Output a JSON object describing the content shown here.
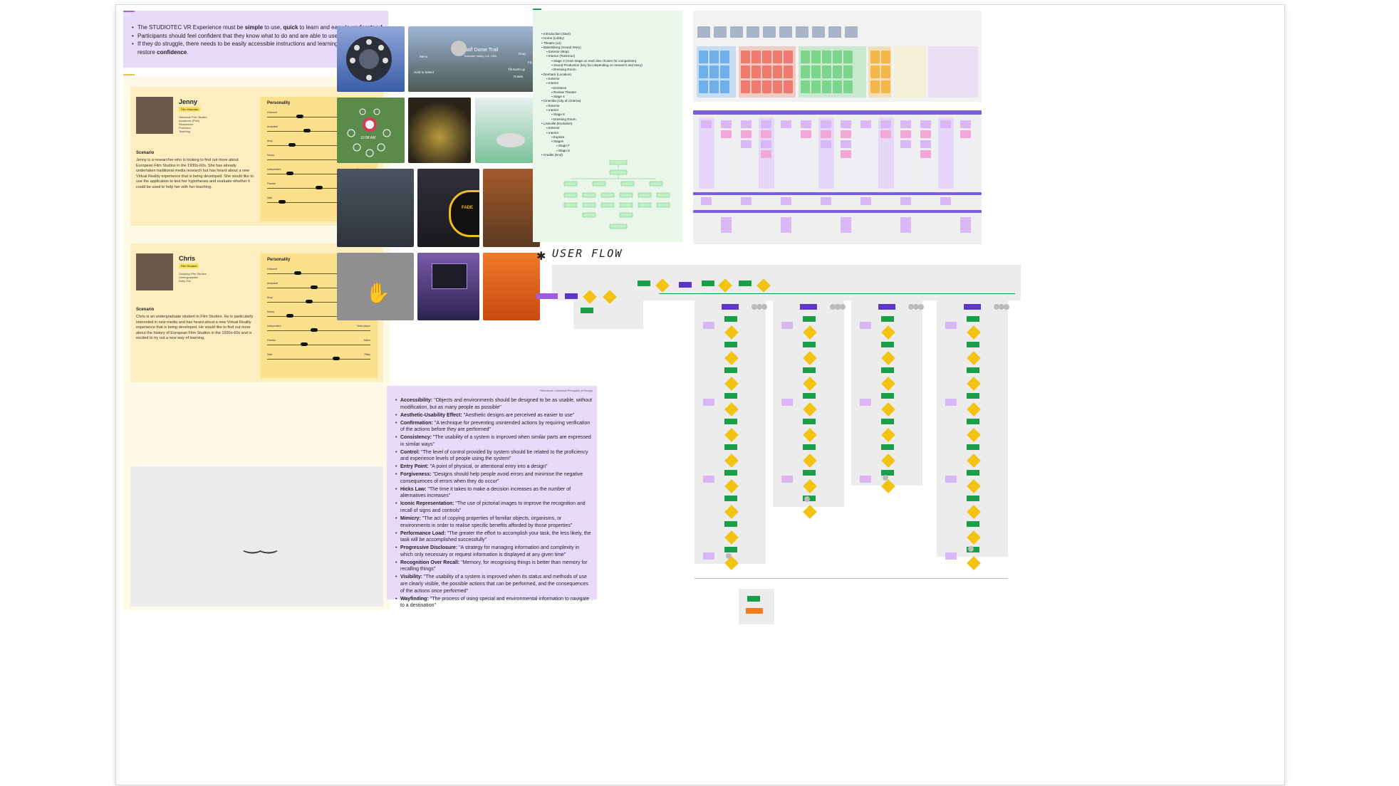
{
  "goals": {
    "items": [
      {
        "a": "The STUDIOTEC VR Experience must be ",
        "b": "simple",
        "c": " to use, ",
        "d": "quick",
        "e": " to learn and easy to ",
        "f": "understand",
        "g": "."
      },
      {
        "a": "Participants should feel confident that they know what to do and are able to use ",
        "b": "independently",
        "c": ".",
        "d": "",
        "e": "",
        "f": "",
        "g": ""
      },
      {
        "a": "If they do struggle, there needs to be easily accessible instructions and learning opportunities to restore ",
        "b": "confidence",
        "c": ".",
        "d": "",
        "e": "",
        "f": "",
        "g": ""
      }
    ]
  },
  "personas": [
    {
      "name": "Jenny",
      "role": "Film Historian",
      "facts": [
        "Historical Film Studies",
        "Academic (PhD)",
        "Researcher",
        "Professor",
        "Teaching"
      ],
      "scenario_title": "Scenario",
      "scenario": "Jenny is a researcher who is looking to find out more about European Film Studios in the 1930s-60s. She has already undertaken traditional media research but has heard about a new Virtual Reality experience that is being developed. She would like to use the application to test her hypotheses and evaluate whether it could be used to help her with her teaching.",
      "personality_title": "Personality",
      "traits": [
        {
          "l": "Extrovert",
          "r": "Introvert",
          "v": 0.3
        },
        {
          "l": "Analytical",
          "r": "Creative",
          "v": 0.38
        },
        {
          "l": "Busy",
          "r": "Time-rich",
          "v": 0.22
        },
        {
          "l": "Messy",
          "r": "Organised",
          "v": 0.9
        },
        {
          "l": "Independent",
          "r": "Team player",
          "v": 0.2
        },
        {
          "l": "Passive",
          "r": "Active",
          "v": 0.5
        },
        {
          "l": "Safe",
          "r": "Risky",
          "v": 0.12
        }
      ]
    },
    {
      "name": "Chris",
      "role": "Film Student",
      "facts": [
        "Studying Film Studies",
        "Undergraduate",
        "Early 20s"
      ],
      "scenario_title": "Scenario",
      "scenario": "Chris is an undergraduate student in Film Studies. He is particularly interested in new media and has heard about a new Virtual Reality experience that is being developed. He would like to find out more about the history of European Film Studios in the 1930s-60s and is excited to try out a new way of learning.",
      "personality_title": "Personality",
      "traits": [
        {
          "l": "Extrovert",
          "r": "Introvert",
          "v": 0.28
        },
        {
          "l": "Analytical",
          "r": "Creative",
          "v": 0.45
        },
        {
          "l": "Busy",
          "r": "Time-rich",
          "v": 0.4
        },
        {
          "l": "Messy",
          "r": "Organised",
          "v": 0.2
        },
        {
          "l": "Independent",
          "r": "Team player",
          "v": 0.45
        },
        {
          "l": "Passive",
          "r": "Active",
          "v": 0.35
        },
        {
          "l": "Safe",
          "r": "Risky",
          "v": 0.68
        }
      ]
    }
  ],
  "screens": {
    "halfdome_title": "Half Dome Trail",
    "halfdome_sub": "Yosemite Valley, CA, USA",
    "menu": "Menu",
    "hold": "Hold to Select",
    "tilt": "Tilt Earth up",
    "rotate": "Rotate",
    "drag": "Drag",
    "fly": "Fly",
    "time": "10:58 AM",
    "fade": "FADE"
  },
  "principles": {
    "header": "Reference: Universal Principles of Design",
    "items": [
      {
        "t": "Accessibility:",
        "d": " \"Objects and environments should be designed to be as usable, without modification, but as many people as possible\""
      },
      {
        "t": "Aesthetic-Usability Effect:",
        "d": " \"Aesthetic designs are perceived as easier to use\""
      },
      {
        "t": "Confirmation:",
        "d": " \"A technique for preventing unintended actions by requiring verification of the actions before they are performed\""
      },
      {
        "t": "Consistency:",
        "d": " \"The usability of a system is improved when similar parts are expressed in similar ways\""
      },
      {
        "t": "Control:",
        "d": " \"The level of control provided by system should be related to the proficiency and experience levels of people using the system\""
      },
      {
        "t": "Entry Point:",
        "d": " \"A point of physical, or attentional entry into a design\""
      },
      {
        "t": "Forgiveness:",
        "d": " \"Designs should help people avoid errors and minimise the negative consequences of errors when they do occur\""
      },
      {
        "t": "Hicks Law:",
        "d": " \"The time it takes to make a decision increases as the number of alternatives increases\""
      },
      {
        "t": "Iconic Representation:",
        "d": " \"The use of pictorial images to improve the recognition and recall of signs and controls\""
      },
      {
        "t": "Mimicry:",
        "d": " \"The act of copying properties of familiar objects, organisms, or environments in order to realise specific benefits afforded by those properties\""
      },
      {
        "t": "Performance Load:",
        "d": " \"The greater the effort to accomplish your task, the less likely, the task will be accomplished successfully\""
      },
      {
        "t": "Progressive Disclosure:",
        "d": " \"A strategy for managing information and complexity in which only necessary or request information is displayed at any given time\""
      },
      {
        "t": "Recognition Over Recall:",
        "d": " \"Memory, for recognising things is better than memory for recalling things\""
      },
      {
        "t": "Visibility:",
        "d": " \"The usability of a system is improved when its status and methods of use are clearly visible, the possible actions that can be performed, and the consequences of the actions once performed\""
      },
      {
        "t": "Wayfinding:",
        "d": " \"The process of using special and environmental information to navigate to a destination\""
      }
    ]
  },
  "structure": {
    "items": [
      {
        "lvl": 0,
        "t": "Introduction (Start)"
      },
      {
        "lvl": 0,
        "t": "Home (Lobby)"
      },
      {
        "lvl": 0,
        "t": "Theatre (x4)"
      },
      {
        "lvl": 0,
        "t": "Babelsberg (Sound Story)"
      },
      {
        "lvl": 1,
        "t": "Exterior (Map)"
      },
      {
        "lvl": 1,
        "t": "Interior (Tonkreuz)"
      },
      {
        "lvl": 2,
        "t": "Stage 3 (main stage on each site chosen for comparison)"
      },
      {
        "lvl": 2,
        "t": "Sound Production (key foci depending on research and story)"
      },
      {
        "lvl": 2,
        "t": "Dressing Room"
      },
      {
        "lvl": 0,
        "t": "Denham (Location)"
      },
      {
        "lvl": 1,
        "t": "Exterior"
      },
      {
        "lvl": 1,
        "t": "Interior"
      },
      {
        "lvl": 2,
        "t": "Entrance"
      },
      {
        "lvl": 2,
        "t": "Review Theatre"
      },
      {
        "lvl": 2,
        "t": "Stage 4"
      },
      {
        "lvl": 0,
        "t": "Cinecitta (City of Cinema)"
      },
      {
        "lvl": 1,
        "t": "Exterior"
      },
      {
        "lvl": 1,
        "t": "Interior"
      },
      {
        "lvl": 2,
        "t": "Stage 8"
      },
      {
        "lvl": 2,
        "t": "Dressing Room"
      },
      {
        "lvl": 0,
        "t": "Lisinville (Evolution)"
      },
      {
        "lvl": 1,
        "t": "Exterior"
      },
      {
        "lvl": 1,
        "t": "Interior"
      },
      {
        "lvl": 2,
        "t": "Explore"
      },
      {
        "lvl": 2,
        "t": "Stages"
      },
      {
        "lvl": 3,
        "t": "Stage F"
      },
      {
        "lvl": 3,
        "t": "Stage E"
      },
      {
        "lvl": 0,
        "t": "Credits (End)"
      }
    ]
  },
  "userflow": {
    "title": "USER FLOW"
  },
  "colors": {
    "purple": "#e8dafb",
    "yellow": "#fdeec0",
    "green": "#1a9e4a",
    "diamond": "#f3c314"
  }
}
